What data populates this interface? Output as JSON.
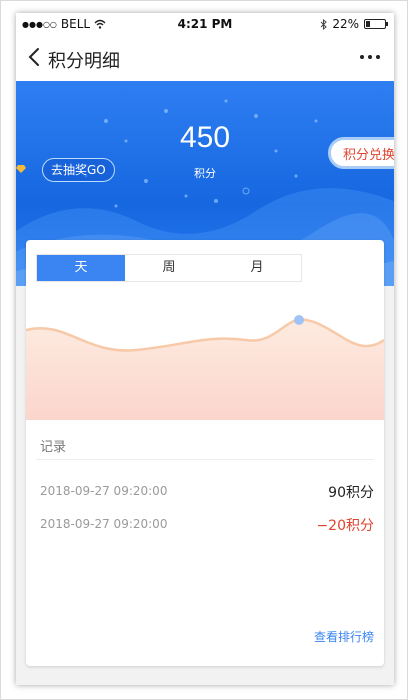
{
  "status_bar": {
    "carrier": "BELL",
    "time": "4:21 PM",
    "battery": "22%",
    "battery_level": 0.22
  },
  "nav": {
    "title": "积分明细"
  },
  "hero": {
    "points": "450",
    "points_label": "积分",
    "lottery_button": "去抽奖GO",
    "exchange_button": "积分兑换"
  },
  "tabs": [
    "天",
    "周",
    "月"
  ],
  "active_tab": "天",
  "records": {
    "title": "记录",
    "items": [
      {
        "time": "2018-09-27  09:20:00",
        "amount": "90积分",
        "type": "positive"
      },
      {
        "time": "2018-09-27  09:20:00",
        "amount": "−20积分",
        "type": "negative"
      }
    ],
    "rank_link": "查看排行榜"
  },
  "colors": {
    "accent": "#3a85f1",
    "hero_blue": "#1667e0",
    "negative": "#e0432f",
    "curve": "#f7c9a8"
  }
}
